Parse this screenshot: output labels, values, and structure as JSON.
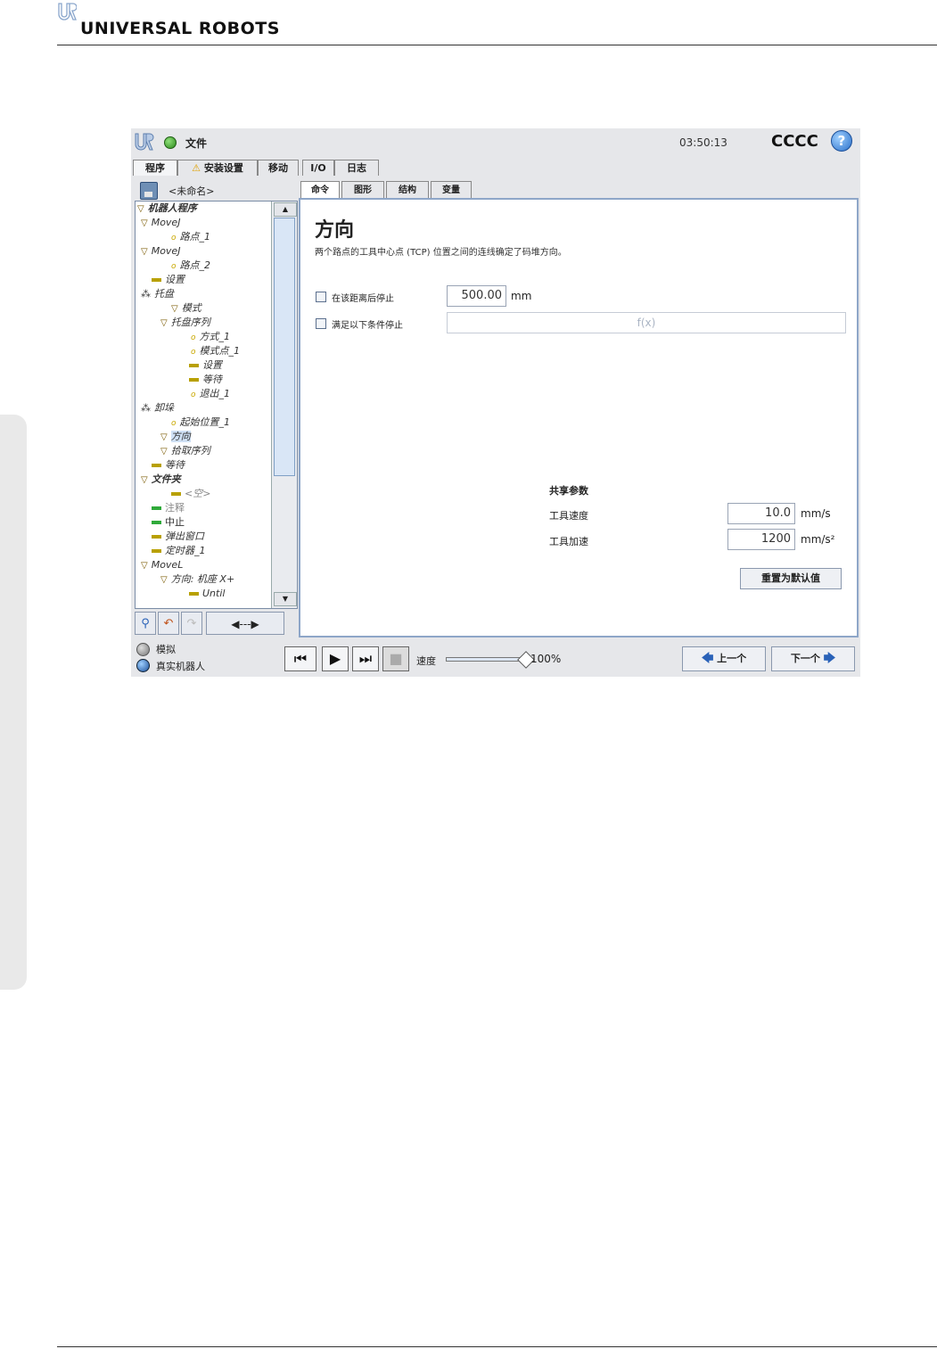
{
  "page": {
    "brand": "UNIVERSAL ROBOTS"
  },
  "app": {
    "title": "文件",
    "clock": "03:50:13",
    "robot_name": "CCCC",
    "help": "?",
    "main_tabs": [
      "程序",
      "安装设置",
      "移动",
      "I/O",
      "日志"
    ],
    "program_name": "<未命名>",
    "sub_tabs": [
      "命令",
      "图形",
      "结构",
      "变量"
    ],
    "tree": [
      {
        "label": "机器人程序",
        "icon": "triangle-down"
      },
      {
        "label": "MoveJ",
        "icon": "triangle-down"
      },
      {
        "label": "路点_1",
        "icon": "waypoint"
      },
      {
        "label": "MoveJ",
        "icon": "triangle-down"
      },
      {
        "label": "路点_2",
        "icon": "waypoint"
      },
      {
        "label": "设置",
        "icon": "set-bar"
      },
      {
        "label": "托盘",
        "icon": "pallet"
      },
      {
        "label": "模式",
        "icon": "triangle-down"
      },
      {
        "label": "托盘序列",
        "icon": "triangle-down"
      },
      {
        "label": "方式_1",
        "icon": "waypoint"
      },
      {
        "label": "模式点_1",
        "icon": "waypoint"
      },
      {
        "label": "设置",
        "icon": "set-bar"
      },
      {
        "label": "等待",
        "icon": "wait-bar"
      },
      {
        "label": "退出_1",
        "icon": "waypoint"
      },
      {
        "label": "卸垛",
        "icon": "pallet"
      },
      {
        "label": "起始位置_1",
        "icon": "waypoint"
      },
      {
        "label": "方向",
        "icon": "triangle-down"
      },
      {
        "label": "拾取序列",
        "icon": "triangle-down"
      },
      {
        "label": "等待",
        "icon": "wait-bar"
      },
      {
        "label": "文件夹",
        "icon": "triangle-down"
      },
      {
        "label": "<空>",
        "icon": "set-bar"
      },
      {
        "label": "注释",
        "icon": "comment-bar"
      },
      {
        "label": "中止",
        "icon": "halt-bar"
      },
      {
        "label": "弹出窗口",
        "icon": "popup-bar"
      },
      {
        "label": "定时器_1",
        "icon": "timer-bar"
      },
      {
        "label": "MoveL",
        "icon": "triangle-down"
      },
      {
        "label": "方向: 机座 X+",
        "icon": "triangle-down"
      },
      {
        "label": "Until",
        "icon": "set-bar"
      }
    ],
    "command": {
      "title": "方向",
      "description": "两个路点的工具中心点 (TCP) 位置之间的连线确定了码堆方向。",
      "stop_after_distance_label": "在该距离后停止",
      "distance_value": "500.00",
      "distance_unit": "mm",
      "stop_condition_label": "满足以下条件停止",
      "condition_placeholder": "f(x)",
      "shared_params_title": "共享参数",
      "tool_speed_label": "工具速度",
      "tool_speed_value": "10.0",
      "tool_speed_unit": "mm/s",
      "tool_accel_label": "工具加速",
      "tool_accel_value": "1200",
      "tool_accel_unit": "mm/s²",
      "reset_button": "重置为默认值"
    },
    "bottom": {
      "mode_sim": "模拟",
      "mode_real": "真实机器人",
      "speed_label": "速度",
      "speed_value": "100%",
      "speed_fraction": 1.0,
      "prev_button": "上一个",
      "next_button": "下一个"
    }
  }
}
